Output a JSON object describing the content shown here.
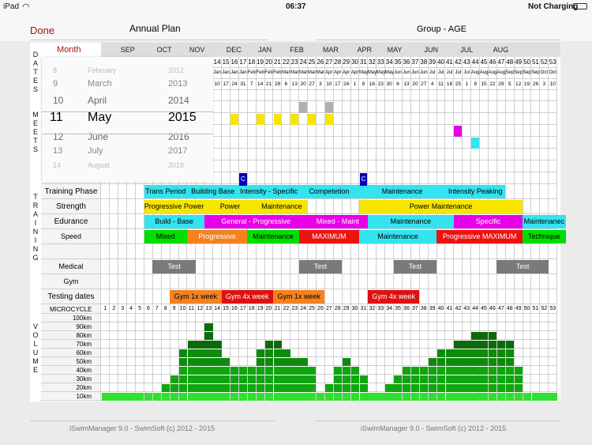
{
  "status": {
    "device": "iPad",
    "time": "06:37",
    "battery": "Not Charging"
  },
  "header": {
    "done": "Done",
    "title": "Annual Plan",
    "group": "Group - AGE"
  },
  "sidebar": {
    "dates": "DATES",
    "meets": "MEETS",
    "training": "TRAINING",
    "volume": "VOLUME"
  },
  "month_label": "Month",
  "months": [
    "SEP",
    "OCT",
    "NOV",
    "DEC",
    "JAN",
    "FEB",
    "MAR",
    "APR",
    "MAY",
    "JUN",
    "JUL",
    "AUG"
  ],
  "weeks": [
    "1",
    "2",
    "3",
    "4",
    "5",
    "6",
    "7",
    "8",
    "9",
    "10",
    "11",
    "12",
    "13",
    "14",
    "15",
    "16",
    "17",
    "18",
    "19",
    "20",
    "21",
    "22",
    "23",
    "24",
    "25",
    "26",
    "27",
    "28",
    "29",
    "30",
    "31",
    "32",
    "33",
    "34",
    "35",
    "36",
    "37",
    "38",
    "39",
    "40",
    "41",
    "42",
    "43",
    "44",
    "45",
    "46",
    "47",
    "48",
    "49",
    "50",
    "51",
    "52",
    "53"
  ],
  "week_months": [
    "",
    "",
    "",
    "",
    "",
    "",
    "",
    "",
    "",
    "",
    "",
    "",
    "",
    "Jan",
    "Jan",
    "Jan",
    "Jan",
    "Feb",
    "Feb",
    "Feb",
    "Feb",
    "Mar",
    "Mar",
    "Mar",
    "Mar",
    "Mar",
    "Apr",
    "Apr",
    "Apr",
    "Apr",
    "May",
    "May",
    "May",
    "May",
    "Jun",
    "Jun",
    "Jun",
    "Jun",
    "Jul",
    "Jul",
    "Jul",
    "Jul",
    "Jul",
    "Aug",
    "Aug",
    "Aug",
    "Aug",
    "Sep",
    "Sep",
    "Sep",
    "Sep",
    "Oct",
    "Oct"
  ],
  "week_days": [
    "",
    "",
    "",
    "",
    "",
    "",
    "",
    "",
    "",
    "",
    "",
    "",
    "",
    "10",
    "17",
    "24",
    "31",
    "7",
    "14",
    "21",
    "28",
    "6",
    "13",
    "20",
    "27",
    "3",
    "10",
    "17",
    "24",
    "1",
    "8",
    "16",
    "23",
    "30",
    "6",
    "13",
    "20",
    "27",
    "4",
    "11",
    "18",
    "25",
    "1",
    "8",
    "15",
    "22",
    "29",
    "5",
    "12",
    "19",
    "26",
    "3",
    "10"
  ],
  "picker": {
    "rows": [
      {
        "day": "8",
        "month": "February",
        "year": "2012"
      },
      {
        "day": "9",
        "month": "March",
        "year": "2013"
      },
      {
        "day": "10",
        "month": "April",
        "year": "2014"
      },
      {
        "day": "11",
        "month": "May",
        "year": "2015"
      },
      {
        "day": "12",
        "month": "June",
        "year": "2016"
      },
      {
        "day": "13",
        "month": "July",
        "year": "2017"
      },
      {
        "day": "14",
        "month": "August",
        "year": "2018"
      }
    ],
    "selected_index": 3
  },
  "meets": [
    {
      "row": 0,
      "week": 23,
      "color": "#b0b0b0"
    },
    {
      "row": 0,
      "week": 26,
      "color": "#b0b0b0"
    },
    {
      "row": 1,
      "week": 15,
      "color": "#f7e500"
    },
    {
      "row": 1,
      "week": 18,
      "color": "#f7e500"
    },
    {
      "row": 1,
      "week": 20,
      "color": "#f7e500"
    },
    {
      "row": 1,
      "week": 22,
      "color": "#f7e500"
    },
    {
      "row": 1,
      "week": 24,
      "color": "#f7e500"
    },
    {
      "row": 1,
      "week": 26,
      "color": "#f7e500"
    },
    {
      "row": 2,
      "week": 41,
      "color": "#e800e8"
    },
    {
      "row": 3,
      "week": 43,
      "color": "#33e3ef"
    }
  ],
  "c_markers": [
    {
      "week": 16,
      "label": "C",
      "color": "#0000bb"
    },
    {
      "week": 30,
      "label": "C",
      "color": "#0000bb"
    }
  ],
  "training_rows": [
    {
      "label": "Training Phase",
      "bars": [
        {
          "start": 5,
          "span": 5,
          "text": "Trans Period",
          "bg": "#33e3ef",
          "fg": "#000"
        },
        {
          "start": 10,
          "span": 6,
          "text": "Building Base",
          "bg": "#33e3ef",
          "fg": "#000"
        },
        {
          "start": 16,
          "span": 7,
          "text": "Intensity - Specific",
          "bg": "#33e3ef",
          "fg": "#000"
        },
        {
          "start": 23,
          "span": 7,
          "text": "Competetion",
          "bg": "#33e3ef",
          "fg": "#000"
        },
        {
          "start": 30,
          "span": 10,
          "text": "Maintenance",
          "bg": "#33e3ef",
          "fg": "#000"
        },
        {
          "start": 40,
          "span": 7,
          "text": "Intensity Peaking",
          "bg": "#33e3ef",
          "fg": "#000"
        }
      ]
    },
    {
      "label": "Strength",
      "bars": [
        {
          "start": 5,
          "span": 7,
          "text": "Progressive Power",
          "bg": "#f7e500",
          "fg": "#000"
        },
        {
          "start": 12,
          "span": 6,
          "text": "Power",
          "bg": "#f7e500",
          "fg": "#000"
        },
        {
          "start": 18,
          "span": 6,
          "text": "Maintenance",
          "bg": "#f7e500",
          "fg": "#000"
        },
        {
          "start": 30,
          "span": 19,
          "text": "Power Maintenance",
          "bg": "#f7e500",
          "fg": "#000"
        }
      ]
    },
    {
      "label": "Edurance",
      "bars": [
        {
          "start": 5,
          "span": 7,
          "text": "Build - Base",
          "bg": "#33e3ef",
          "fg": "#000"
        },
        {
          "start": 12,
          "span": 12,
          "text": "General - Progressive",
          "bg": "#e800e8",
          "fg": "#fff"
        },
        {
          "start": 24,
          "span": 7,
          "text": "Mixed - Maint",
          "bg": "#e800e8",
          "fg": "#fff"
        },
        {
          "start": 31,
          "span": 10,
          "text": "Maintenance",
          "bg": "#33e3ef",
          "fg": "#000"
        },
        {
          "start": 41,
          "span": 8,
          "text": "Specific",
          "bg": "#e800e8",
          "fg": "#fff"
        },
        {
          "start": 49,
          "span": 5,
          "text": "Maintenanec",
          "bg": "#33e3ef",
          "fg": "#000"
        }
      ]
    },
    {
      "label": "Speed",
      "bars": [
        {
          "start": 5,
          "span": 5,
          "text": "Mixed",
          "bg": "#00dd00",
          "fg": "#000"
        },
        {
          "start": 10,
          "span": 7,
          "text": "Progressive",
          "bg": "#f5821f",
          "fg": "#fff"
        },
        {
          "start": 17,
          "span": 6,
          "text": "Maintenance",
          "bg": "#00dd00",
          "fg": "#000"
        },
        {
          "start": 23,
          "span": 7,
          "text": "MAXIMUM",
          "bg": "#ee1111",
          "fg": "#fff"
        },
        {
          "start": 30,
          "span": 9,
          "text": "Maintenance",
          "bg": "#33e3ef",
          "fg": "#000"
        },
        {
          "start": 39,
          "span": 10,
          "text": "Progressive MAXIMUM",
          "bg": "#ee1111",
          "fg": "#fff"
        },
        {
          "start": 49,
          "span": 5,
          "text": "Technique",
          "bg": "#00dd00",
          "fg": "#000"
        }
      ]
    },
    {
      "label": "",
      "bars": []
    },
    {
      "label": "Medical",
      "bars": [
        {
          "start": 6,
          "span": 5,
          "text": "Test",
          "bg": "#7a7a7a",
          "fg": "#fff"
        },
        {
          "start": 23,
          "span": 5,
          "text": "Test",
          "bg": "#7a7a7a",
          "fg": "#fff"
        },
        {
          "start": 34,
          "span": 5,
          "text": "Test",
          "bg": "#7a7a7a",
          "fg": "#fff"
        },
        {
          "start": 46,
          "span": 6,
          "text": "Test",
          "bg": "#7a7a7a",
          "fg": "#fff"
        }
      ]
    },
    {
      "label": "Gym",
      "bars": []
    },
    {
      "label": "Testing dates",
      "bars": [
        {
          "start": 8,
          "span": 6,
          "text": "Gym 1x week",
          "bg": "#f5821f",
          "fg": "#000"
        },
        {
          "start": 14,
          "span": 6,
          "text": "Gym 4x week",
          "bg": "#dd1111",
          "fg": "#fff"
        },
        {
          "start": 20,
          "span": 6,
          "text": "Gym 1x week",
          "bg": "#f5821f",
          "fg": "#000"
        },
        {
          "start": 31,
          "span": 6,
          "text": "Gym 4x week",
          "bg": "#dd1111",
          "fg": "#fff"
        }
      ]
    }
  ],
  "microcycle_label": "MICROCYCLE",
  "volume_levels": [
    "100km",
    "90km",
    "80km",
    "70km",
    "60km",
    "50km",
    "40km",
    "30km",
    "20km",
    "10km"
  ],
  "volume_weekly_km": [
    10,
    10,
    10,
    10,
    10,
    10,
    10,
    20,
    30,
    60,
    70,
    70,
    90,
    70,
    50,
    40,
    40,
    40,
    60,
    70,
    70,
    60,
    50,
    50,
    40,
    10,
    20,
    40,
    50,
    40,
    30,
    10,
    10,
    20,
    30,
    40,
    40,
    40,
    50,
    60,
    60,
    70,
    70,
    80,
    80,
    80,
    70,
    70,
    40,
    10,
    10,
    10,
    10
  ],
  "volume_colors": {
    "top": "#0b6b0b",
    "mid": "#0f8a0f",
    "low": "#10a610",
    "base": "#2fe02f"
  },
  "footer": {
    "left": "iSwimManager 9.0 - SwimSoft (c) 2012 - 2015",
    "right": "iSwimManager 9.0 - SwimSoft (c) 2012 - 2015"
  }
}
